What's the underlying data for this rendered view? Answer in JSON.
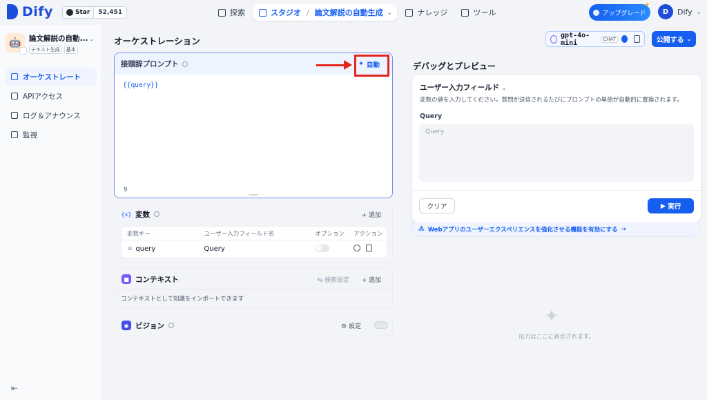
{
  "brand": {
    "name": "Dify",
    "accent": "#155eef"
  },
  "github": {
    "star_label": "Star",
    "count": "52,451"
  },
  "nav": {
    "explore": "探索",
    "studio": "スタジオ",
    "separator": "/",
    "current_app": "論文解説の自動生成",
    "knowledge": "ナレッジ",
    "tools": "ツール"
  },
  "header": {
    "upgrade": "アップグレード",
    "user_initial": "D",
    "user_name": "Dify"
  },
  "sidebar": {
    "app_name": "論文解説の自動...",
    "tags": [
      "テキスト生成",
      "基本"
    ],
    "items": [
      {
        "label": "オーケストレート",
        "icon": "layout-icon"
      },
      {
        "label": "APIアクセス",
        "icon": "terminal-icon"
      },
      {
        "label": "ログ＆アナウンス",
        "icon": "file-list-icon"
      },
      {
        "label": "監視",
        "icon": "dashboard-icon"
      }
    ]
  },
  "main": {
    "title": "オーケストレーション",
    "publish": "公開する"
  },
  "model": {
    "name": "gpt-4o-mini",
    "badge": "CHAT"
  },
  "prompt": {
    "title": "接頭辞プロンプト",
    "auto": "自動",
    "content": "{{query}}",
    "char_count": "9"
  },
  "variables": {
    "title": "変数",
    "add": "+ 追加",
    "columns": [
      "変数キー",
      "ユーザー入力フィールド名",
      "オプション",
      "アクション"
    ],
    "rows": [
      {
        "key": "query",
        "name": "Query",
        "optional": false
      }
    ]
  },
  "context": {
    "title": "コンテキスト",
    "retrieval": "検索設定",
    "add": "+ 追加",
    "description": "コンテキストとして知識をインポートできます"
  },
  "vision": {
    "title": "ビジョン",
    "settings": "設定"
  },
  "debug": {
    "title": "デバッグとプレビュー",
    "input_title": "ユーザー入力フィールド",
    "description": "変数の値を入力してください。質問が送信されるたびにプロンプトの単語が自動的に置換されます。",
    "field_label": "Query",
    "field_placeholder": "Query",
    "clear": "クリア",
    "run": "実行",
    "feature_link": "Webアプリのユーザーエクスペリエンスを強化させる機能を有効にする",
    "empty": "出力はここに表示されます。"
  }
}
